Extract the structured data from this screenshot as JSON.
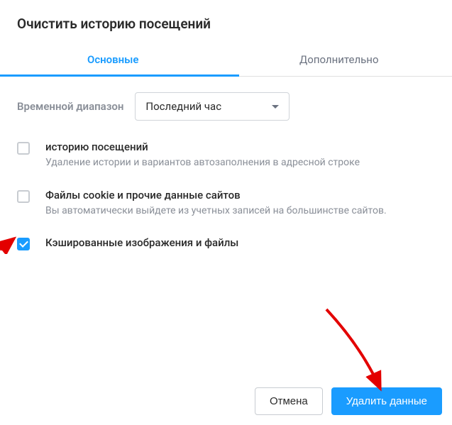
{
  "title": "Очистить историю посещений",
  "tabs": {
    "basic": "Основные",
    "advanced": "Дополнительно"
  },
  "timerange": {
    "label": "Временной диапазон",
    "value": "Последний час"
  },
  "options": {
    "history": {
      "title": "историю посещений",
      "desc": "Удаление истории и вариантов автозаполнения в адресной строке",
      "checked": false
    },
    "cookies": {
      "title": "Файлы cookie и прочие данные сайтов",
      "desc": "Вы автоматически выйдете из учетных записей на большинстве сайтов.",
      "checked": false
    },
    "cache": {
      "title": "Кэшированные изображения и файлы",
      "desc": "",
      "checked": true
    }
  },
  "buttons": {
    "cancel": "Отмена",
    "confirm": "Удалить данные"
  }
}
